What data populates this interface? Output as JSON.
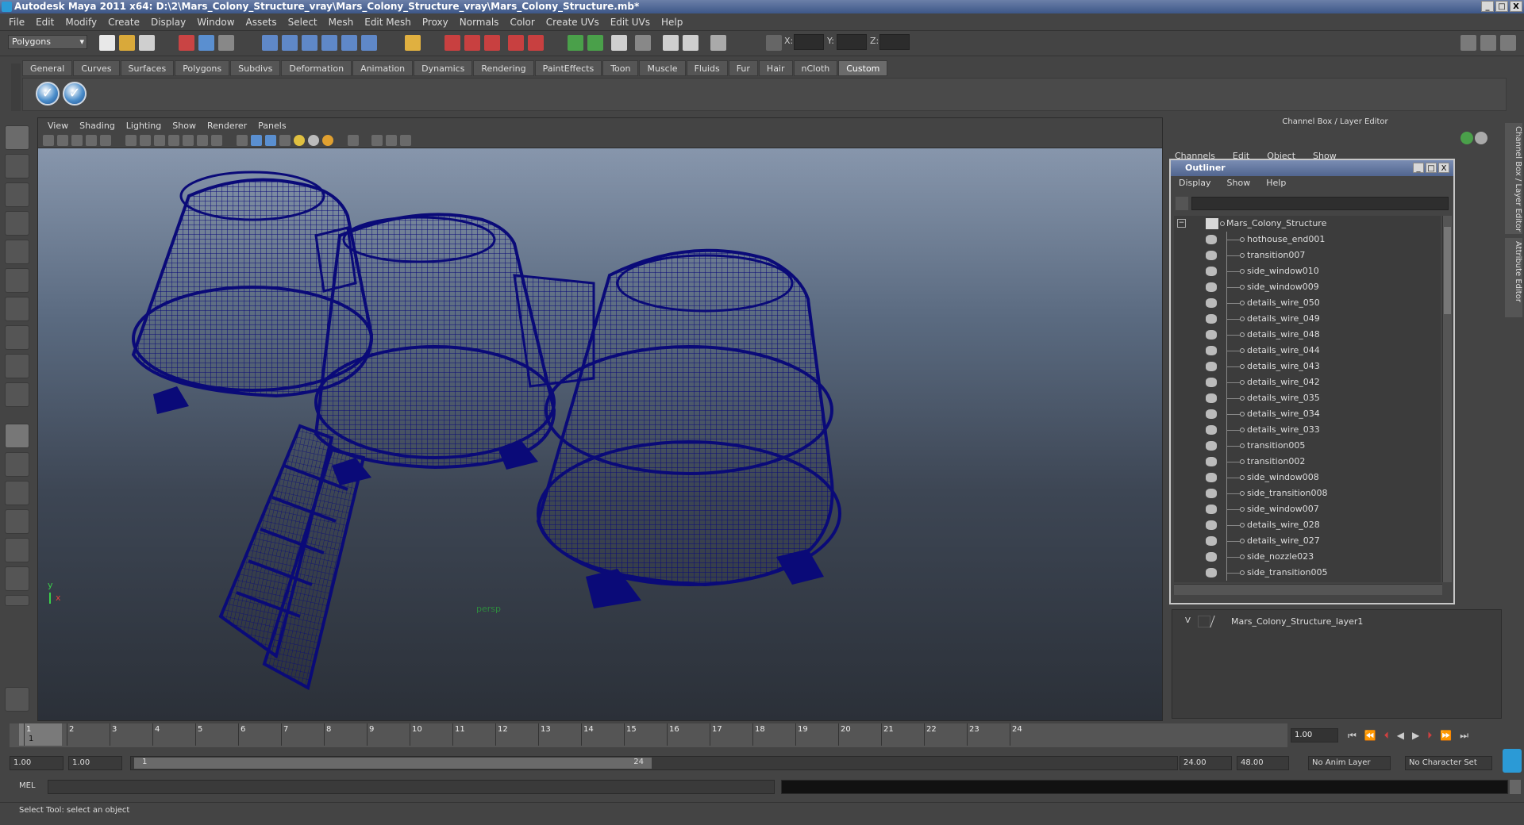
{
  "window": {
    "title": "Autodesk Maya 2011 x64: D:\\2\\Mars_Colony_Structure_vray\\Mars_Colony_Structure_vray\\Mars_Colony_Structure.mb*",
    "min": "_",
    "max": "□",
    "close": "X"
  },
  "menubar": [
    "File",
    "Edit",
    "Modify",
    "Create",
    "Display",
    "Window",
    "Assets",
    "Select",
    "Mesh",
    "Edit Mesh",
    "Proxy",
    "Normals",
    "Color",
    "Create UVs",
    "Edit UVs",
    "Help"
  ],
  "status": {
    "mode": "Polygons",
    "x_label": "X:",
    "y_label": "Y:",
    "z_label": "Z:"
  },
  "shelf_tabs": [
    "General",
    "Curves",
    "Surfaces",
    "Polygons",
    "Subdivs",
    "Deformation",
    "Animation",
    "Dynamics",
    "Rendering",
    "PaintEffects",
    "Toon",
    "Muscle",
    "Fluids",
    "Fur",
    "Hair",
    "nCloth",
    "Custom"
  ],
  "viewport": {
    "menu": [
      "View",
      "Shading",
      "Lighting",
      "Show",
      "Renderer",
      "Panels"
    ],
    "camera_label": "persp",
    "axis_y": "y",
    "axis_x": "x",
    "wire_color": "#0a0a78"
  },
  "channel_box": {
    "title": "Channel Box / Layer Editor",
    "menu": [
      "Channels",
      "Edit",
      "Object",
      "Show"
    ],
    "side_tabs": [
      "Channel Box / Layer Editor",
      "Attribute Editor"
    ]
  },
  "outliner": {
    "title": "Outliner",
    "menu": [
      "Display",
      "Show",
      "Help"
    ],
    "root": "Mars_Colony_Structure",
    "items": [
      "hothouse_end001",
      "transition007",
      "side_window010",
      "side_window009",
      "details_wire_050",
      "details_wire_049",
      "details_wire_048",
      "details_wire_044",
      "details_wire_043",
      "details_wire_042",
      "details_wire_035",
      "details_wire_034",
      "details_wire_033",
      "transition005",
      "transition002",
      "side_window008",
      "side_transition008",
      "side_window007",
      "details_wire_028",
      "details_wire_027",
      "side_nozzle023",
      "side_transition005"
    ]
  },
  "layers": {
    "visible_flag": "V",
    "layer_name": "Mars_Colony_Structure_layer1"
  },
  "timeline": {
    "ticks": [
      "1",
      "2",
      "3",
      "4",
      "5",
      "6",
      "7",
      "8",
      "9",
      "10",
      "11",
      "12",
      "13",
      "14",
      "15",
      "16",
      "17",
      "18",
      "19",
      "20",
      "21",
      "22",
      "23",
      "24"
    ],
    "current_frame": "1",
    "current_field": "1.00"
  },
  "range": {
    "start": "1.00",
    "start2": "1.00",
    "slider_start": "1",
    "slider_end": "24",
    "end": "24.00",
    "end2": "48.00",
    "anim_layer": "No Anim Layer",
    "char_set": "No Character Set"
  },
  "command": {
    "label": "MEL"
  },
  "help_line": "Select Tool: select an object"
}
